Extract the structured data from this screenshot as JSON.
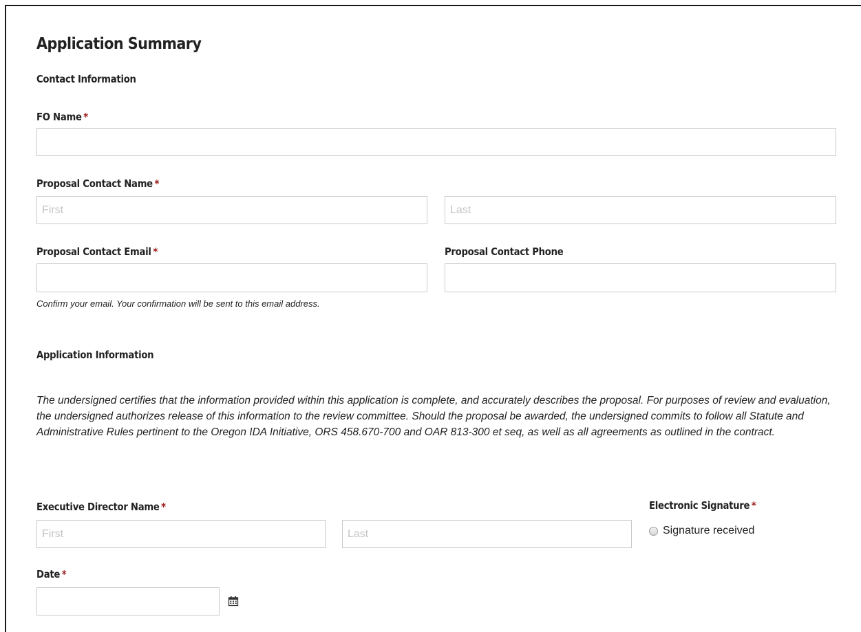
{
  "form": {
    "title": "Application Summary",
    "contact_section": "Contact Information",
    "fo_name": {
      "label": "FO Name",
      "required": "*",
      "value": ""
    },
    "proposal_contact_name": {
      "label": "Proposal Contact Name",
      "required": "*",
      "first_placeholder": "First",
      "last_placeholder": "Last"
    },
    "proposal_contact_email": {
      "label": "Proposal Contact Email",
      "required": "*",
      "value": "",
      "note": "Confirm your email. Your confirmation will be sent to this email address."
    },
    "proposal_contact_phone": {
      "label": "Proposal Contact Phone",
      "value": ""
    },
    "application_section": "Application Information",
    "certification_text": "The undersigned certifies that the information provided within this application is complete, and accurately describes the proposal. For purposes of review and evaluation, the undersigned authorizes release of this information to the review committee. Should the proposal be awarded, the undersigned commits to follow all Statute and Administrative Rules pertinent to the Oregon IDA Initiative, ORS 458.670-700 and OAR 813-300 et seq, as well as all agreements as outlined in the contract.",
    "executive_director_name": {
      "label": "Executive Director Name",
      "required": "*",
      "first_placeholder": "First",
      "last_placeholder": "Last"
    },
    "electronic_signature": {
      "label": "Electronic Signature",
      "required": "*",
      "option": "Signature received"
    },
    "date": {
      "label": "Date",
      "required": "*",
      "value": "",
      "icon": "calendar-icon"
    }
  }
}
